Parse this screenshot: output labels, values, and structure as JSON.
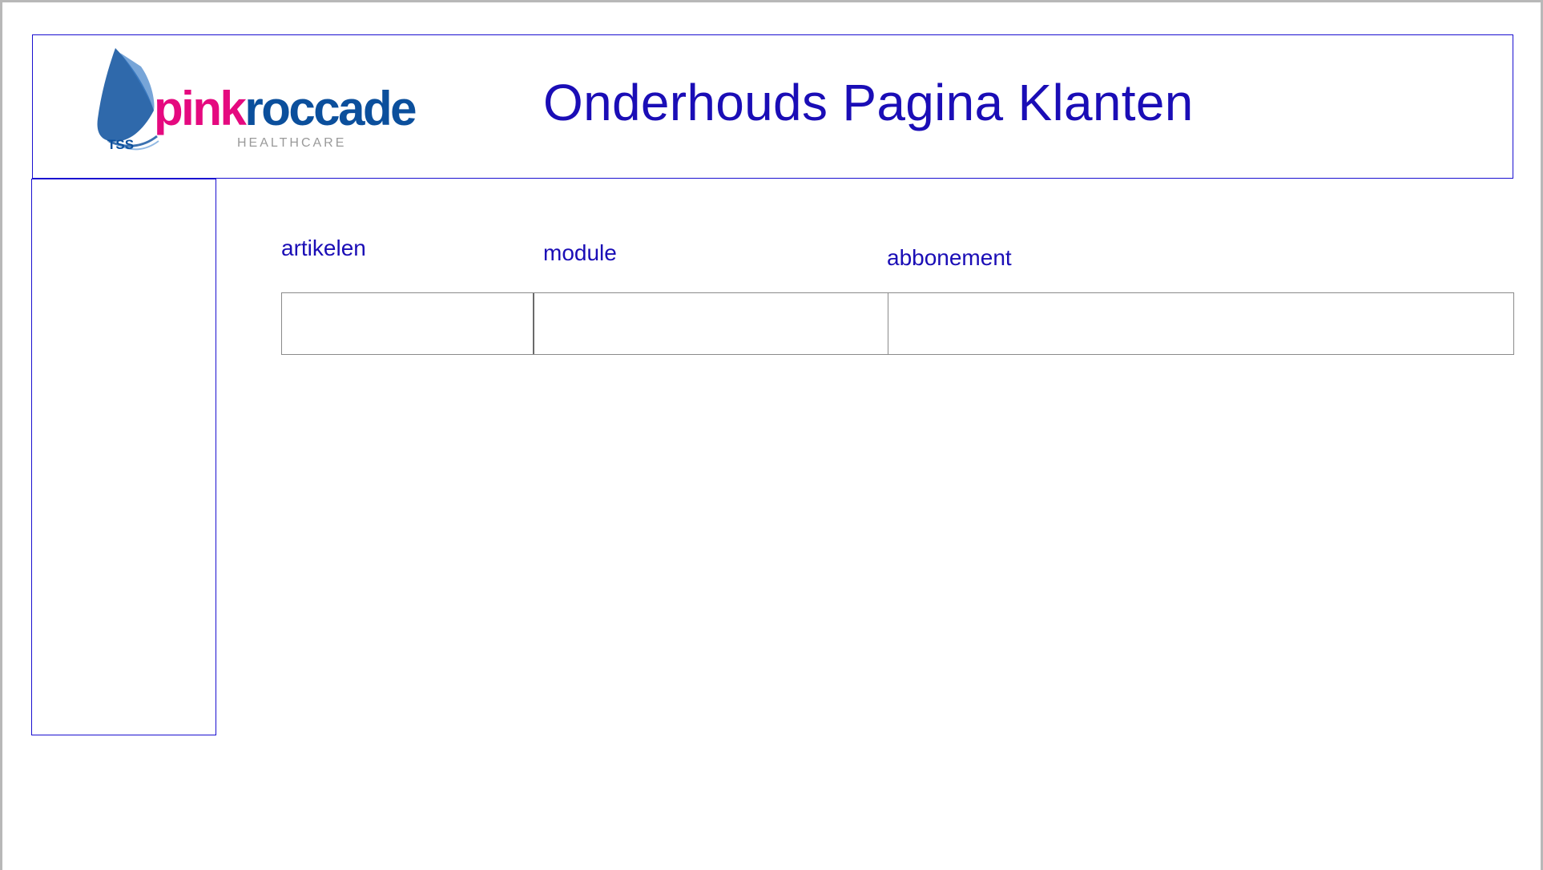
{
  "header": {
    "logo": {
      "brand_pink": "pink",
      "brand_blue": "roccade",
      "tag": "TSS",
      "subtitle": "HEALTHCARE",
      "colors": {
        "pink": "#e5097f",
        "blue": "#0b4f9c",
        "grey": "#9a9a9a"
      }
    },
    "title": "Onderhouds Pagina Klanten"
  },
  "sidebar": {
    "items": []
  },
  "form": {
    "labels": {
      "artikelen": "artikelen",
      "module": "module",
      "abbonement": "abbonement"
    },
    "fields": {
      "artikelen": {
        "value": "",
        "placeholder": ""
      },
      "module": {
        "value": "",
        "placeholder": ""
      },
      "abbonement": {
        "value": "",
        "placeholder": ""
      }
    }
  },
  "colors": {
    "accent": "#1a0db6",
    "frame_border": "#1a0fd0",
    "field_border": "#8a8a8a"
  }
}
